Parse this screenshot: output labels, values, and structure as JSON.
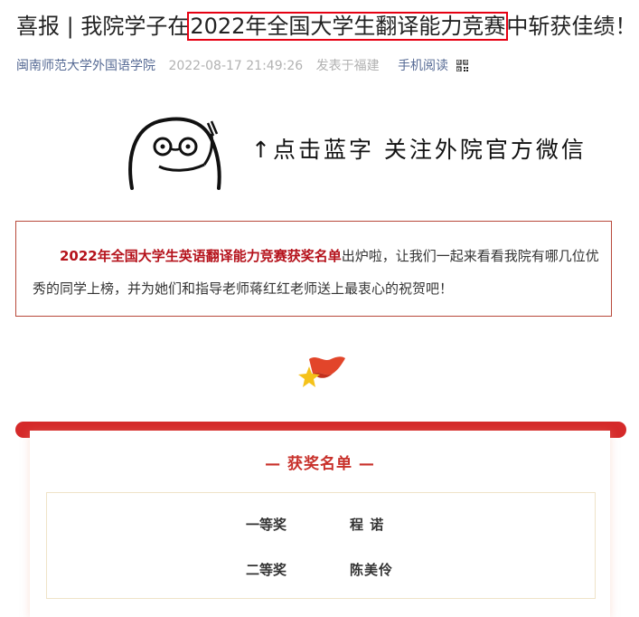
{
  "article": {
    "title_prefix": "喜报 | 我院学子在",
    "title_highlight": "2022年全国大学生翻译能力竞赛",
    "title_suffix": "中斩获佳绩！",
    "account": "闽南师范大学外国语学院",
    "datetime": "2022-08-17 21:49:26",
    "location": "发表于福建",
    "mobile_read": "手机阅读"
  },
  "banner": {
    "text": "↑点击蓝字 关注外院官方微信"
  },
  "intro": {
    "bold_lead": "2022年全国大学生英语翻译能力竞赛获奖名单",
    "body": "出炉啦，让我们一起来看看我院有哪几位优秀的同学上榜，并为她们和指导老师蒋红红老师送上最衷心的祝贺吧！"
  },
  "award_card": {
    "title": "— 获奖名单 —",
    "rows": [
      {
        "level": "一等奖",
        "winner": "程 诺"
      },
      {
        "level": "二等奖",
        "winner": "陈美伶"
      }
    ]
  },
  "colors": {
    "highlight_border": "#e60012",
    "link_blue": "#576b95",
    "accent_red": "#c8302a",
    "intro_border": "#b8493a"
  }
}
